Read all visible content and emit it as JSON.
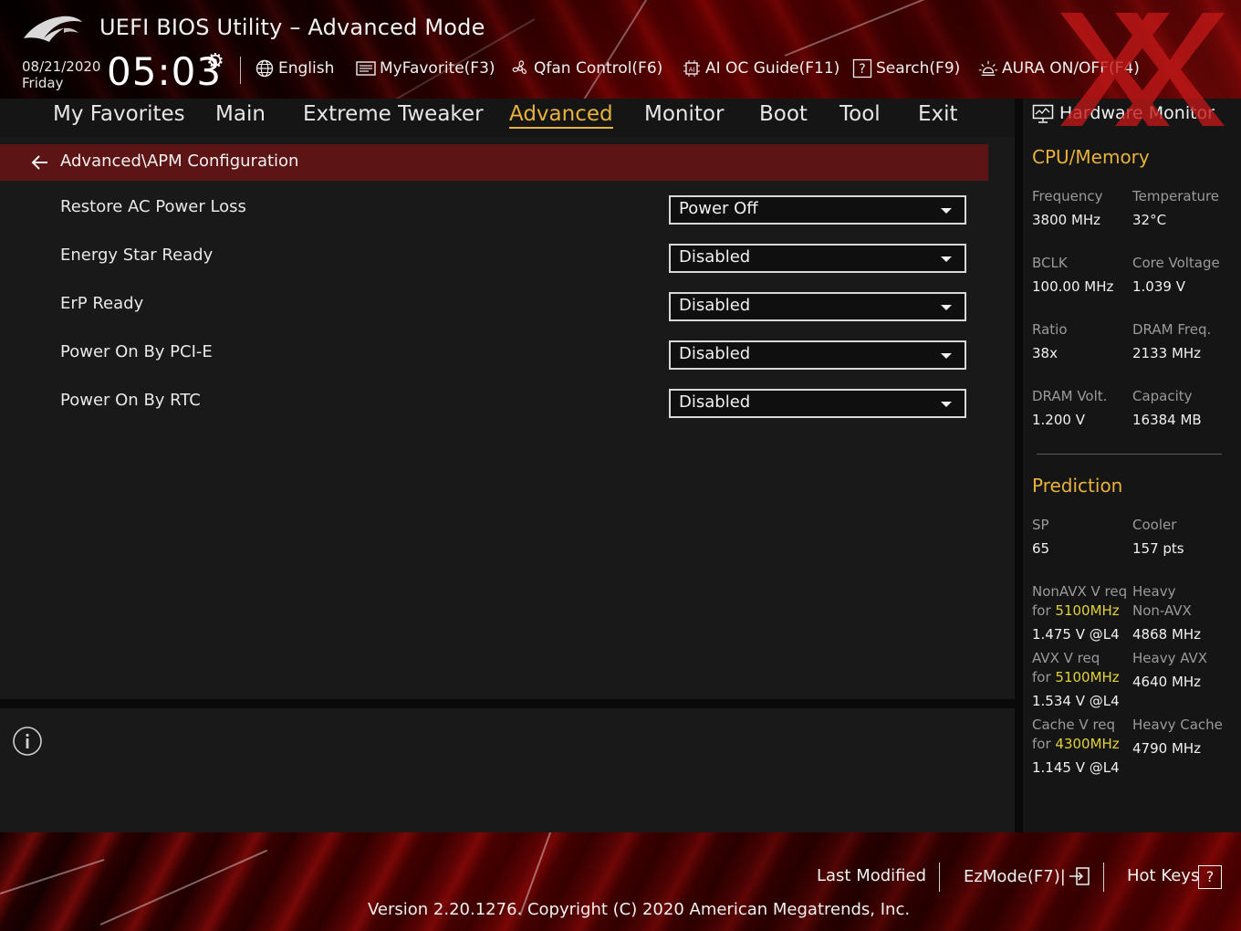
{
  "header": {
    "title": "UEFI BIOS Utility – Advanced Mode",
    "date": "08/21/2020",
    "day": "Friday",
    "time": "05:03",
    "toolbar": {
      "language": "English",
      "my_favorite": "MyFavorite(F3)",
      "qfan": "Qfan Control(F6)",
      "ai_oc": "AI OC Guide(F11)",
      "search": "Search(F9)",
      "aura": "AURA ON/OFF(F4)"
    }
  },
  "nav": {
    "tabs": [
      "My Favorites",
      "Main",
      "Extreme Tweaker",
      "Advanced",
      "Monitor",
      "Boot",
      "Tool",
      "Exit"
    ],
    "active": "Advanced"
  },
  "breadcrumb": "Advanced\\APM Configuration",
  "settings": [
    {
      "label": "Restore AC Power Loss",
      "value": "Power Off"
    },
    {
      "label": "Energy Star Ready",
      "value": "Disabled"
    },
    {
      "label": "ErP Ready",
      "value": "Disabled"
    },
    {
      "label": "Power On By PCI-E",
      "value": "Disabled"
    },
    {
      "label": "Power On By RTC",
      "value": "Disabled"
    }
  ],
  "hw_monitor": {
    "title": "Hardware Monitor",
    "cpu_memory": {
      "heading": "CPU/Memory",
      "frequency_label": "Frequency",
      "frequency": "3800 MHz",
      "temperature_label": "Temperature",
      "temperature": "32°C",
      "bclk_label": "BCLK",
      "bclk": "100.00 MHz",
      "core_voltage_label": "Core Voltage",
      "core_voltage": "1.039 V",
      "ratio_label": "Ratio",
      "ratio": "38x",
      "dram_freq_label": "DRAM Freq.",
      "dram_freq": "2133 MHz",
      "dram_volt_label": "DRAM Volt.",
      "dram_volt": "1.200 V",
      "capacity_label": "Capacity",
      "capacity": "16384 MB"
    },
    "prediction": {
      "heading": "Prediction",
      "sp_label": "SP",
      "sp": "65",
      "cooler_label": "Cooler",
      "cooler": "157 pts",
      "nonavx_req_l1": "NonAVX V req",
      "for_word": "for",
      "nonavx_freq": "5100MHz",
      "nonavx_v": "1.475 V @L4",
      "heavy_nonavx_l1": "Heavy",
      "heavy_nonavx_l2": "Non-AVX",
      "heavy_nonavx": "4868 MHz",
      "avx_req_l1": "AVX V req",
      "avx_freq": "5100MHz",
      "avx_v": "1.534 V @L4",
      "heavy_avx_label": "Heavy AVX",
      "heavy_avx": "4640 MHz",
      "cache_req_l1": "Cache V req",
      "cache_freq": "4300MHz",
      "cache_v": "1.145 V @L4",
      "heavy_cache_label": "Heavy Cache",
      "heavy_cache": "4790 MHz"
    }
  },
  "footer": {
    "last_modified": "Last Modified",
    "ezmode": "EzMode(F7)|",
    "hot_keys": "Hot Keys",
    "hot_keys_icon_text": "?",
    "version": "Version 2.20.1276. Copyright (C) 2020 American Megatrends, Inc."
  },
  "colors": {
    "accent": "#e8b23c",
    "breadcrumb_bg": "#5c1414",
    "highlight_freq": "#e3d13a"
  }
}
